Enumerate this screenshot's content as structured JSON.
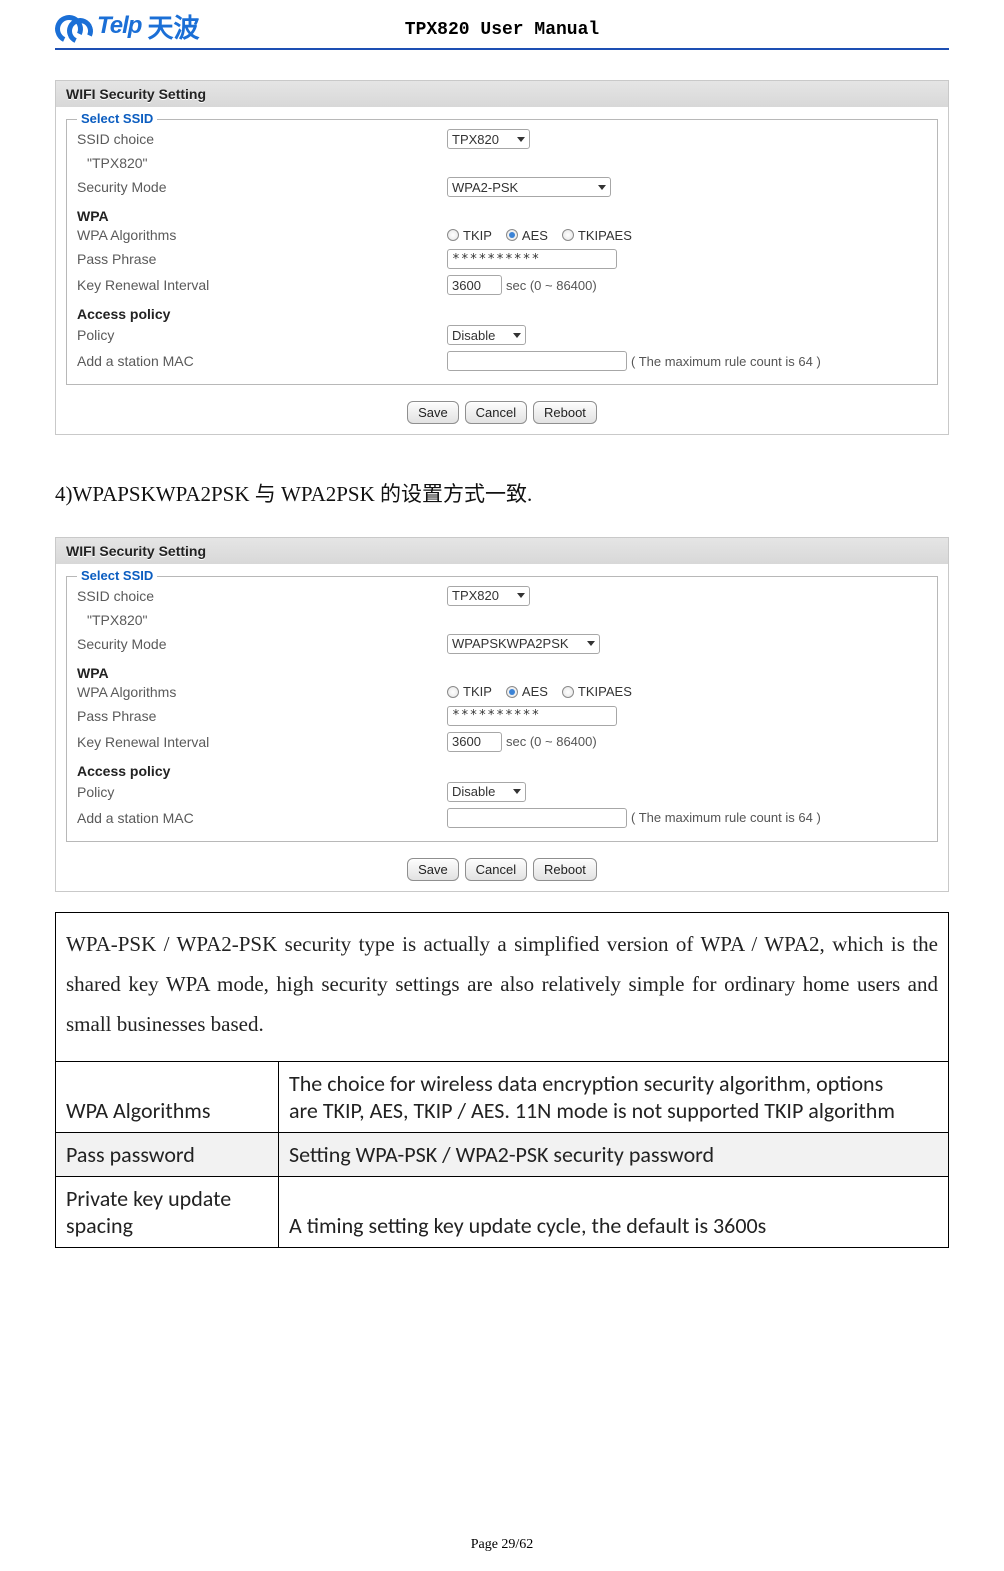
{
  "header": {
    "logo_text": "Telp",
    "logo_cn": "天波",
    "doc_title": "TPX820 User Manual"
  },
  "screenshot1": {
    "title": "WIFI Security Setting",
    "legend": "Select SSID",
    "ssid_choice_lbl": "SSID choice",
    "ssid_choice_val": "TPX820",
    "ssid_quote": "\"TPX820\"",
    "sec_mode_lbl": "Security Mode",
    "sec_mode_val": "WPA2-PSK",
    "wpa_hdr": "WPA",
    "wpa_alg_lbl": "WPA Algorithms",
    "alg_tkip": "TKIP",
    "alg_aes": "AES",
    "alg_both": "TKIPAES",
    "pass_lbl": "Pass Phrase",
    "pass_val": "**********",
    "key_lbl": "Key Renewal Interval",
    "key_val": "3600",
    "key_unit": "sec   (0 ~ 86400)",
    "ap_hdr": "Access policy",
    "policy_lbl": "Policy",
    "policy_val": "Disable",
    "mac_lbl": "Add a station MAC",
    "mac_note": "( The maximum rule count is 64 )",
    "btn_save": "Save",
    "btn_cancel": "Cancel",
    "btn_reboot": "Reboot"
  },
  "paragraph1": "4)WPAPSKWPA2PSK 与 WPA2PSK 的设置方式一致.",
  "screenshot2": {
    "sec_mode_val": "WPAPSKWPA2PSK"
  },
  "table": {
    "desc": "WPA-PSK / WPA2-PSK security type is actually a simplified version of WPA / WPA2, which is the shared key WPA mode, high security settings are also relatively simple for ordinary home users and small businesses based.",
    "r1c1": "WPA Algorithms",
    "r1c2": "The choice for wireless data encryption security algorithm, options\nare TKIP, AES, TKIP / AES. 11N mode is not supported TKIP algorithm",
    "r2c1": "Pass password",
    "r2c2": "Setting WPA-PSK / WPA2-PSK security password",
    "r3c1": "Private key update spacing",
    "r3c2": "A timing setting key update cycle, the default is 3600s"
  },
  "page_footer": "Page 29/62"
}
